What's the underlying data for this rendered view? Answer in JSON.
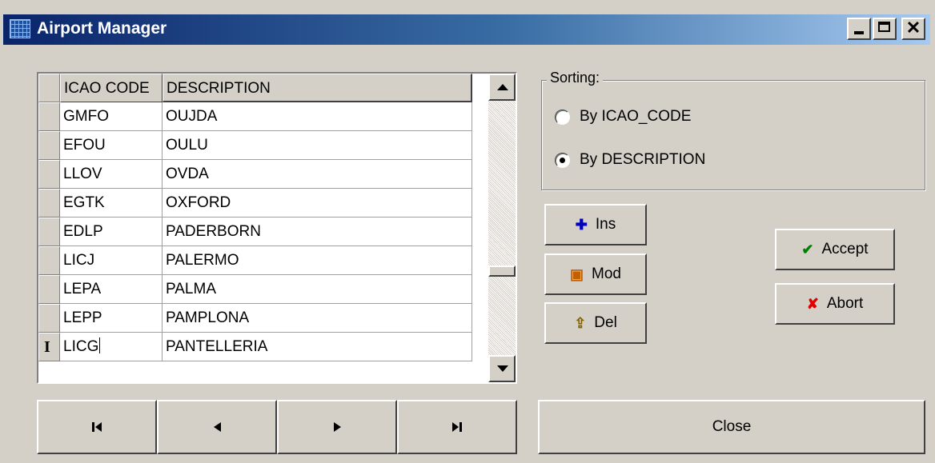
{
  "window": {
    "title": "Airport Manager"
  },
  "title_buttons": {
    "minimize": "minimize-icon",
    "maximize": "maximize-icon",
    "close": "close-icon"
  },
  "grid": {
    "columns": [
      "ICAO CODE",
      "DESCRIPTION"
    ],
    "rows": [
      {
        "code": "GMFO",
        "description": "OUJDA"
      },
      {
        "code": "EFOU",
        "description": "OULU"
      },
      {
        "code": "LLOV",
        "description": "OVDA"
      },
      {
        "code": "EGTK",
        "description": "OXFORD"
      },
      {
        "code": "EDLP",
        "description": "PADERBORN"
      },
      {
        "code": "LICJ",
        "description": "PALERMO"
      },
      {
        "code": "LEPA",
        "description": "PALMA"
      },
      {
        "code": "LEPP",
        "description": "PAMPLONA"
      },
      {
        "code": "LICG",
        "description": "PANTELLERIA"
      }
    ],
    "editing_indicator": "I"
  },
  "sorting": {
    "legend": "Sorting:",
    "options": [
      {
        "label": "By ICAO_CODE",
        "selected": false
      },
      {
        "label": "By DESCRIPTION",
        "selected": true
      }
    ]
  },
  "actions": {
    "ins": {
      "label": "Ins",
      "icon": "plus-icon",
      "color": "#0000c0"
    },
    "mod": {
      "label": "Mod",
      "icon": "edit-icon",
      "color": "#c06000"
    },
    "del": {
      "label": "Del",
      "icon": "delete-icon",
      "color": "#806000"
    },
    "accept": {
      "label": "Accept",
      "icon": "checkmark-icon",
      "color": "#008000"
    },
    "abort": {
      "label": "Abort",
      "icon": "x-icon",
      "color": "#e00000"
    }
  },
  "navigator": {
    "buttons": [
      "first-record-icon",
      "prior-record-icon",
      "next-record-icon",
      "last-record-icon"
    ]
  },
  "close_label": "Close"
}
